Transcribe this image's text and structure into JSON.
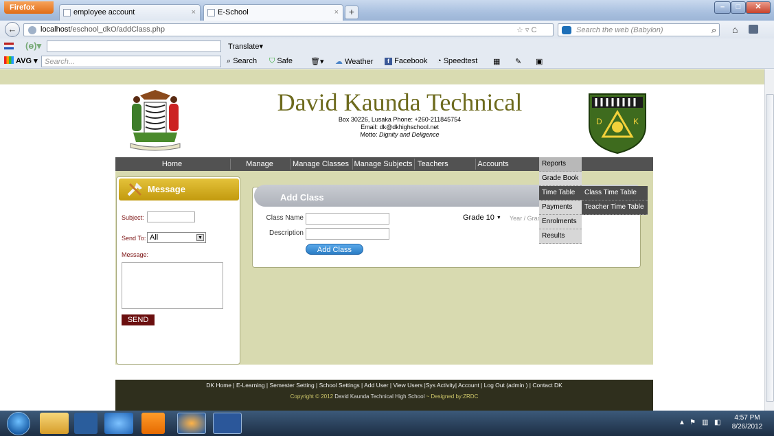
{
  "browser": {
    "app_button": "Firefox",
    "tabs": [
      {
        "label": "employee account"
      },
      {
        "label": "E-School"
      }
    ],
    "new_tab": "+",
    "url_host": "localhost",
    "url_path": "/eschool_dkO/addClass.php",
    "search_placeholder": "Search the web (Babylon)",
    "toolbar1": {
      "translate": "Translate▾"
    },
    "toolbar2": {
      "avg": "AVG ▾",
      "search_placeholder": "Search...",
      "items": [
        "Search",
        "Safe",
        "Weather",
        "Facebook",
        "Speedtest"
      ]
    }
  },
  "header": {
    "school_name": "David Kaunda Technical",
    "address_line": "Box 30226, Lusaka Phone: +260-211845754",
    "email_line": "Email: dk@dkhighschool.net",
    "motto_label": "Motto:",
    "motto": "Dignity and Deligence"
  },
  "menu": {
    "items": [
      "Home",
      "Manage Students",
      "Manage Classes",
      "Manage Subjects",
      "Teachers",
      "Accounts"
    ]
  },
  "dropdown": {
    "items": [
      "Reports",
      "Grade Book",
      "Time Table",
      "Payments",
      "Enrolments",
      "Results"
    ],
    "submenu": [
      "Class Time Table",
      "Teacher Time Table"
    ]
  },
  "message_panel": {
    "title": "Message",
    "subject_label": "Subject:",
    "send_to_label": "Send To:",
    "send_to_value": "All",
    "message_label": "Message:",
    "send_button": "SEND"
  },
  "add_class": {
    "title": "Add Class",
    "class_name_label": "Class Name",
    "description_label": "Description",
    "button": "Add Class",
    "grade_value": "Grade 10",
    "year_grade": "Year / Grade"
  },
  "footer": {
    "links": "DK Home | E-Learning | Semester Setting | School Settings | Add User | View Users |Sys Activity| Account | Log Out (admin ) | Contact DK",
    "copyright": "Copyright © 2012",
    "copyright_org": "David Kaunda Technical High School",
    "designed_by": "~ Designed by:ZRDC"
  },
  "taskbar": {
    "time": "4:57 PM",
    "date": "8/26/2012"
  }
}
